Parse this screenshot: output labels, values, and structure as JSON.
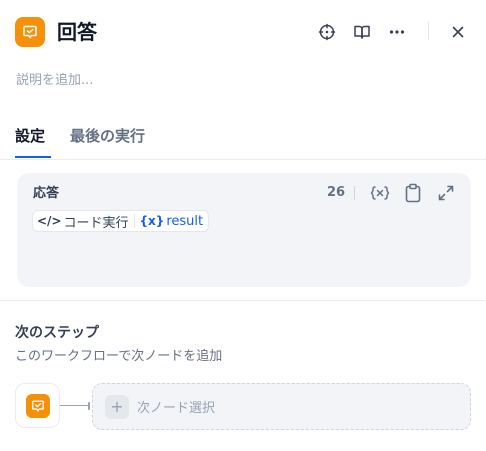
{
  "header": {
    "title": "回答",
    "node_icon": "answer-check-icon",
    "actions": [
      "crosshair-icon",
      "book-open-icon",
      "more-horizontal-icon",
      "close-icon"
    ]
  },
  "description": {
    "placeholder": "説明を追加..."
  },
  "tabs": [
    {
      "label": "設定",
      "active": true
    },
    {
      "label": "最後の実行",
      "active": false
    }
  ],
  "response": {
    "label": "応答",
    "char_count": "26",
    "variable": {
      "code_glyph": "</>",
      "node_name": "コード実行",
      "var_glyph": "{x}",
      "var_name": "result"
    },
    "actions": [
      "variable-icon",
      "clipboard-icon",
      "expand-icon"
    ]
  },
  "next_step": {
    "title": "次のステップ",
    "description": "このワークフローで次ノードを追加",
    "select_label": "次ノード選択",
    "plus": "+"
  },
  "colors": {
    "accent": "#155eef",
    "node": "#f79009",
    "card_bg": "#f2f4f7"
  }
}
